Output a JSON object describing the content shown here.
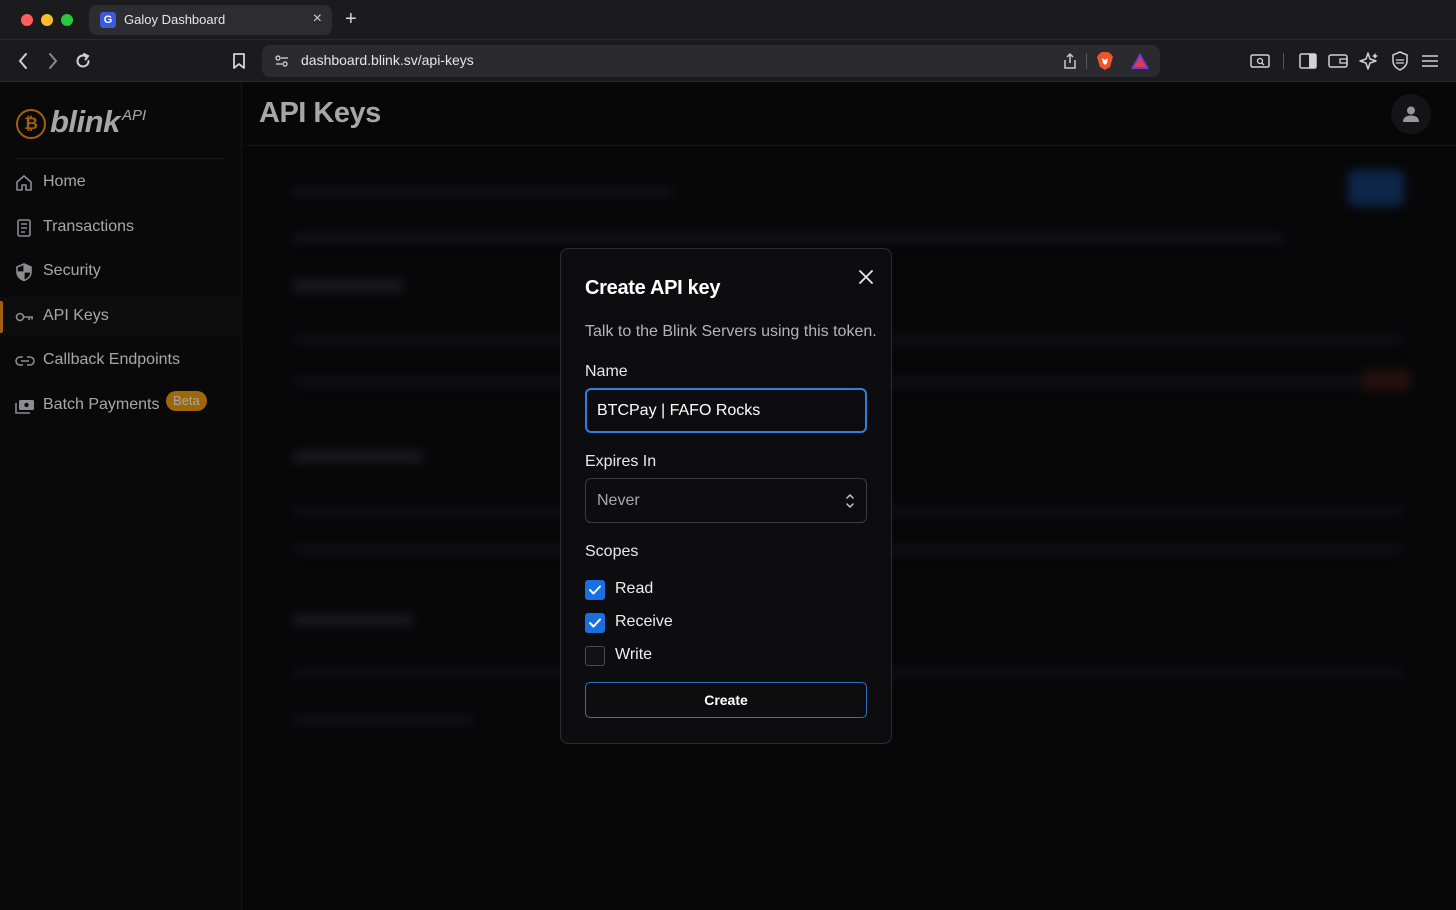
{
  "browser": {
    "tab_title": "Galoy Dashboard",
    "tab_favicon_letter": "G",
    "url": "dashboard.blink.sv/api-keys",
    "icons": [
      "back-icon",
      "forward-icon",
      "reload-icon",
      "bookmark-icon",
      "share-icon",
      "brave-shield-icon",
      "brave-rewards-icon",
      "reader-icon",
      "sidebar-icon",
      "wallet-icon",
      "leo-icon",
      "vpn-icon",
      "menu-icon"
    ]
  },
  "sidebar": {
    "logo_word": "blink",
    "logo_suffix": "API",
    "logo_coin": "₿",
    "items": [
      {
        "label": "Home",
        "icon": "home-icon"
      },
      {
        "label": "Transactions",
        "icon": "receipt-icon"
      },
      {
        "label": "Security",
        "icon": "shield-icon"
      },
      {
        "label": "API Keys",
        "icon": "key-icon",
        "active": true
      },
      {
        "label": "Callback Endpoints",
        "icon": "link-icon"
      },
      {
        "label": "Batch Payments",
        "icon": "payments-icon",
        "badge": "Beta"
      }
    ]
  },
  "main": {
    "title": "API Keys"
  },
  "modal": {
    "title": "Create API key",
    "description": "Talk to the Blink Servers using this token.",
    "name_label": "Name",
    "name_value": "BTCPay | FAFO Rocks",
    "expires_label": "Expires In",
    "expires_value": "Never",
    "scopes_label": "Scopes",
    "scopes": [
      {
        "label": "Read",
        "checked": true
      },
      {
        "label": "Receive",
        "checked": true
      },
      {
        "label": "Write",
        "checked": false
      }
    ],
    "create_label": "Create"
  },
  "colors": {
    "accent_orange": "#f7931a",
    "accent_blue": "#1a6fe0",
    "beta_badge": "#f59f0b"
  }
}
